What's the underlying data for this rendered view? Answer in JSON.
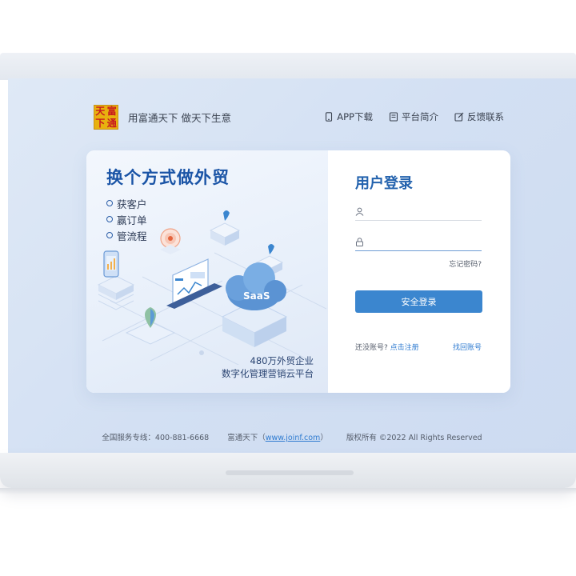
{
  "header": {
    "logo_chars": [
      "天",
      "富",
      "下",
      "通"
    ],
    "slogan": "用富通天下 做天下生意",
    "nav": [
      {
        "label": "APP下载",
        "icon": "phone-icon"
      },
      {
        "label": "平台简介",
        "icon": "document-icon"
      },
      {
        "label": "反馈联系",
        "icon": "edit-icon"
      }
    ]
  },
  "promo": {
    "title": "换个方式做外贸",
    "features": [
      "获客户",
      "赢订单",
      "管流程"
    ],
    "caption_line1": "480万外贸企业",
    "caption_line2": "数字化管理营销云平台",
    "cloud_label": "SaaS"
  },
  "login": {
    "title": "用户登录",
    "username_placeholder": "",
    "password_placeholder": "",
    "forgot": "忘记密码?",
    "submit": "安全登录",
    "no_account": "还没账号?",
    "register": "点击注册",
    "recover": "找回账号"
  },
  "footer": {
    "hotline": "全国服务专线：400-881-6668",
    "company": "富通天下（",
    "website": "www.joinf.com",
    "company_end": "）",
    "copyright": "版权所有 ©2022 All Rights Reserved"
  },
  "colors": {
    "brand_blue": "#2463ae",
    "button_blue": "#3b86cf",
    "link_blue": "#2f7bd0"
  }
}
